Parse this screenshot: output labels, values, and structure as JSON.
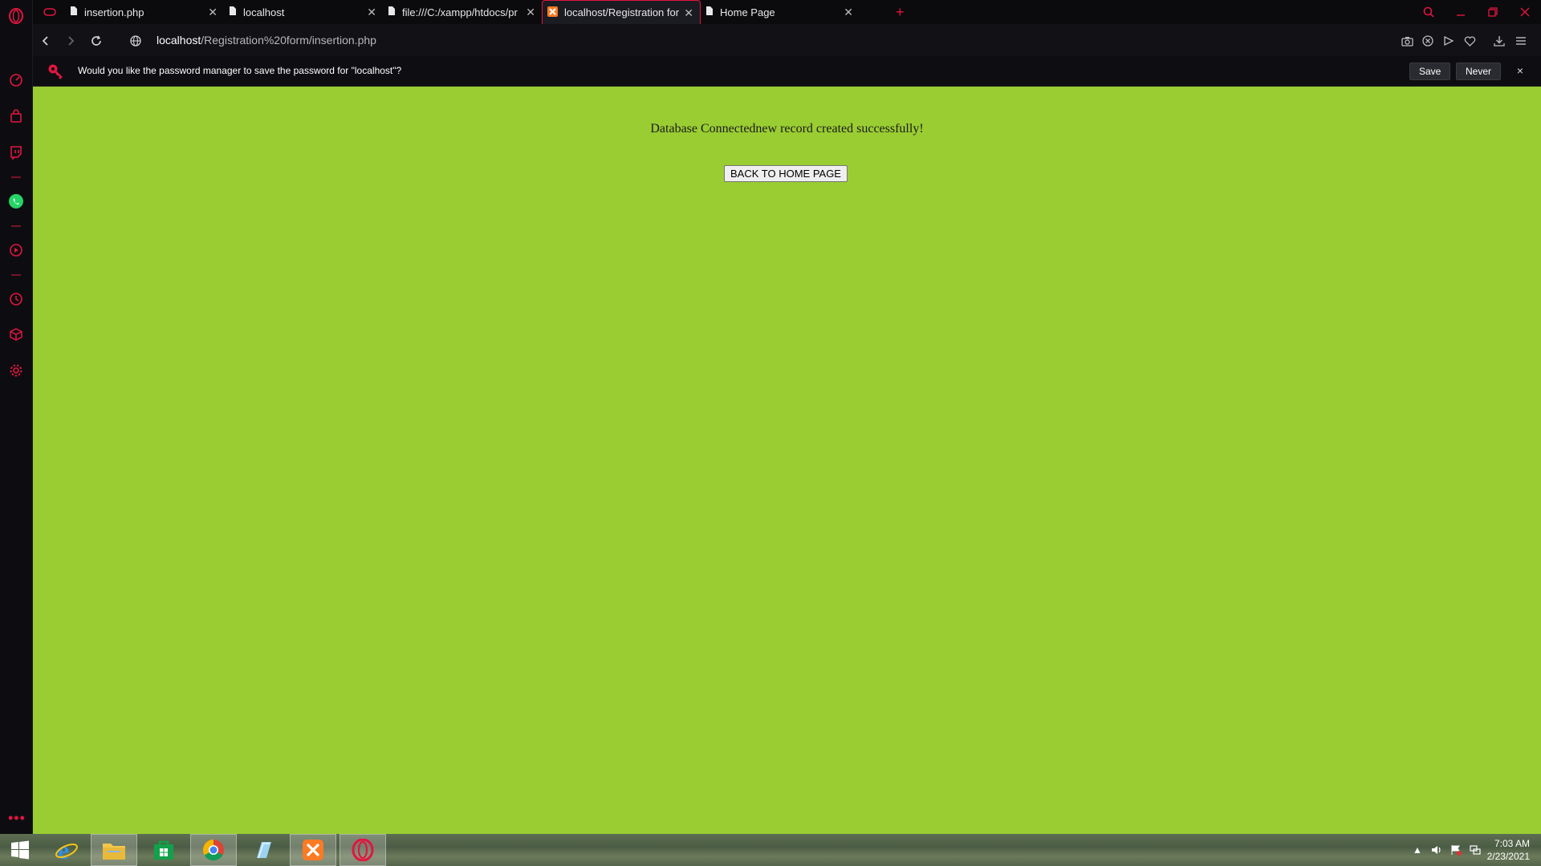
{
  "browser": {
    "tabs": [
      {
        "title": "insertion.php",
        "icon": "document-icon",
        "active": false
      },
      {
        "title": "localhost",
        "icon": "document-icon",
        "active": false
      },
      {
        "title": "file:///C:/xampp/htdocs/pr",
        "icon": "document-icon",
        "active": false
      },
      {
        "title": "localhost/Registration form",
        "icon": "xampp-icon",
        "active": true
      },
      {
        "title": "Home Page",
        "icon": "document-icon",
        "active": false
      }
    ],
    "new_tab_label": "+",
    "address": {
      "host": "localhost",
      "path": "/Registration%20form/insertion.php"
    },
    "password_prompt": {
      "message": "Would you like the password manager to save the password for \"localhost\"?",
      "save_label": "Save",
      "never_label": "Never",
      "close_label": "×"
    }
  },
  "page": {
    "message": "Database Connectednew record created successfully!",
    "back_button_label": "BACK TO HOME PAGE",
    "background_color": "#9acd32"
  },
  "sidebar_icons": [
    "opera-logo-icon",
    "speed-dial-icon",
    "shopping-bag-icon",
    "twitch-icon",
    "whatsapp-icon",
    "player-icon",
    "history-icon",
    "box-icon",
    "gear-icon"
  ],
  "taskbar": {
    "apps": [
      "windows-start-icon",
      "internet-explorer-icon",
      "file-explorer-icon",
      "store-icon",
      "chrome-icon",
      "notepad-icon",
      "xampp-icon",
      "opera-icon"
    ],
    "clock": {
      "time": "7:03 AM",
      "date": "2/23/2021"
    }
  },
  "accent_color": "#e3153f"
}
